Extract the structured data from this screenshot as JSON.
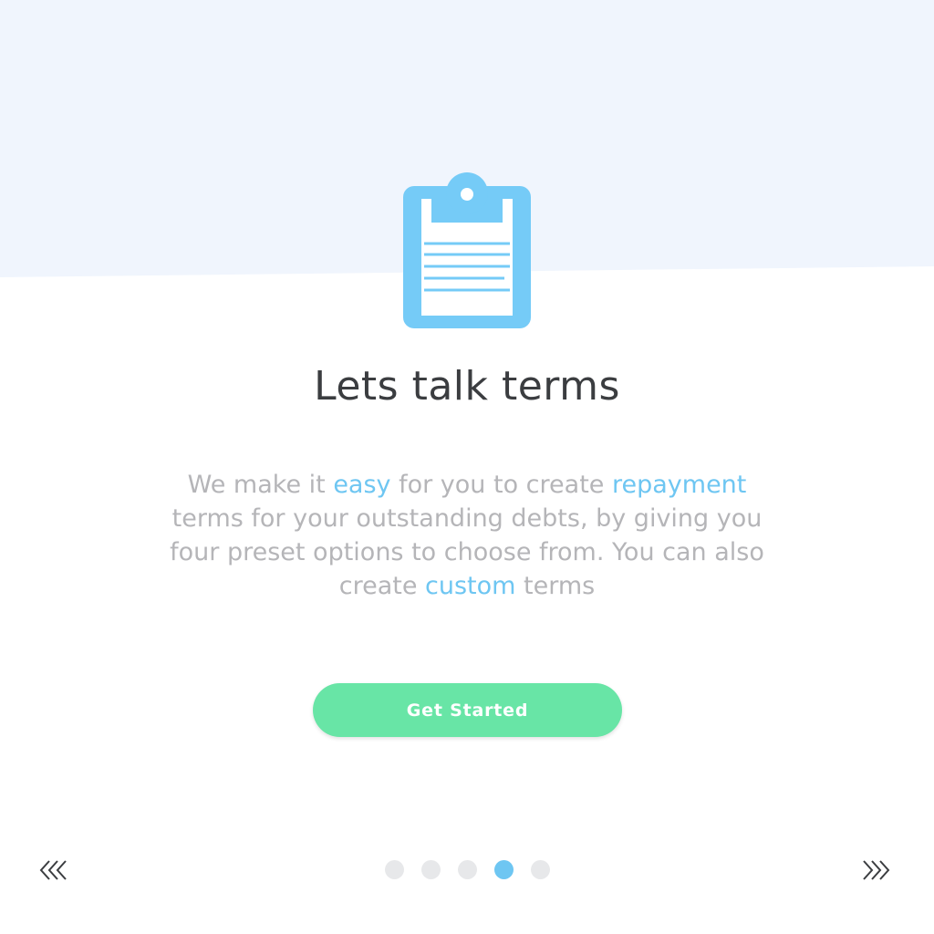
{
  "colors": {
    "top_band": "#f0f5fd",
    "accent": "#6ec6f2",
    "button": "#68e5a6",
    "title": "#3b3d40",
    "body": "#b5b5b8",
    "dot_inactive": "#e7e8ea"
  },
  "illustration": {
    "icon": "clipboard-icon"
  },
  "title": "Lets talk terms",
  "description": {
    "parts": [
      {
        "text": "We make it ",
        "highlight": false
      },
      {
        "text": "easy",
        "highlight": true
      },
      {
        "text": " for you to create ",
        "highlight": false
      },
      {
        "text": "repayment",
        "highlight": true
      },
      {
        "text": " terms for your outstanding debts, by giving you four preset options to choose from. You can also create ",
        "highlight": false
      },
      {
        "text": "custom",
        "highlight": true
      },
      {
        "text": " terms",
        "highlight": false
      }
    ]
  },
  "cta": {
    "label": "Get Started"
  },
  "pagination": {
    "total": 5,
    "active_index": 3
  },
  "navigation": {
    "prev_icon": "double-chevron-left-icon",
    "next_icon": "double-chevron-right-icon"
  }
}
